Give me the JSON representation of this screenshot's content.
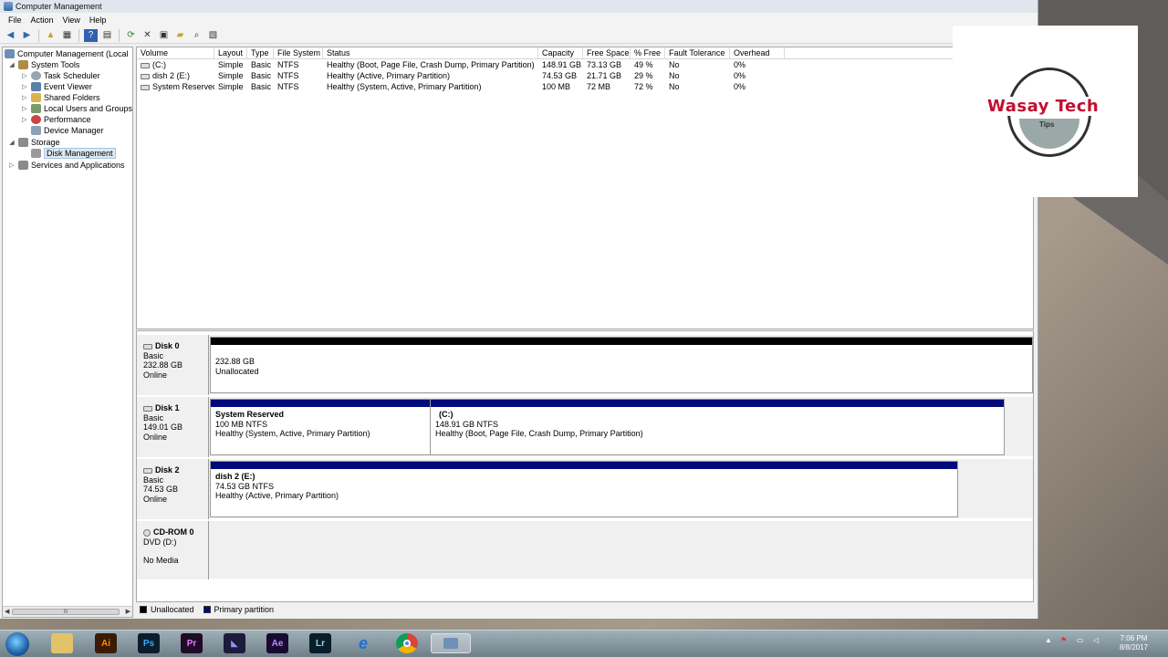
{
  "window": {
    "title": "Computer Management"
  },
  "menu": [
    "File",
    "Action",
    "View",
    "Help"
  ],
  "toolbar": {
    "icons": [
      "back-arrow-icon",
      "forward-arrow-icon",
      "up-folder-icon",
      "show-hide-tree-icon",
      "help-icon",
      "properties-icon",
      "refresh-icon",
      "delete-icon",
      "disk-properties-icon",
      "open-icon",
      "search-icon",
      "export-icon"
    ]
  },
  "tree": {
    "root": "Computer Management (Local",
    "system_tools": "System Tools",
    "task_scheduler": "Task Scheduler",
    "event_viewer": "Event Viewer",
    "shared_folders": "Shared Folders",
    "local_users": "Local Users and Groups",
    "performance": "Performance",
    "device_manager": "Device Manager",
    "storage": "Storage",
    "disk_management": "Disk Management",
    "services": "Services and Applications",
    "hscroll_thumb": "III"
  },
  "volumes": {
    "headers": [
      "Volume",
      "Layout",
      "Type",
      "File System",
      "Status",
      "Capacity",
      "Free Space",
      "% Free",
      "Fault Tolerance",
      "Overhead"
    ],
    "rows": [
      [
        "(C:)",
        "Simple",
        "Basic",
        "NTFS",
        "Healthy (Boot, Page File, Crash Dump, Primary Partition)",
        "148.91 GB",
        "73.13 GB",
        "49 %",
        "No",
        "0%"
      ],
      [
        "dish 2 (E:)",
        "Simple",
        "Basic",
        "NTFS",
        "Healthy (Active, Primary Partition)",
        "74.53 GB",
        "21.71 GB",
        "29 %",
        "No",
        "0%"
      ],
      [
        "System Reserved",
        "Simple",
        "Basic",
        "NTFS",
        "Healthy (System, Active, Primary Partition)",
        "100 MB",
        "72 MB",
        "72 %",
        "No",
        "0%"
      ]
    ]
  },
  "disks": {
    "disk0": {
      "name": "Disk 0",
      "type": "Basic",
      "size": "232.88 GB",
      "state": "Online",
      "p1": {
        "size": "232.88 GB",
        "desc": "Unallocated"
      }
    },
    "disk1": {
      "name": "Disk 1",
      "type": "Basic",
      "size": "149.01 GB",
      "state": "Online",
      "p1": {
        "name": "System Reserved",
        "size": "100 MB NTFS",
        "status": "Healthy (System, Active, Primary Partition)"
      },
      "p2": {
        "name": "(C:)",
        "size": "148.91 GB NTFS",
        "status": "Healthy (Boot, Page File, Crash Dump, Primary Partition)"
      }
    },
    "disk2": {
      "name": "Disk 2",
      "type": "Basic",
      "size": "74.53 GB",
      "state": "Online",
      "p1": {
        "name": "dish 2  (E:)",
        "size": "74.53 GB NTFS",
        "status": "Healthy (Active, Primary Partition)"
      }
    },
    "cdrom": {
      "name": "CD-ROM 0",
      "type": "DVD (D:)",
      "state": "No Media"
    }
  },
  "legend": {
    "unallocated": "Unallocated",
    "primary": "Primary partition"
  },
  "colors": {
    "unallocated": "#000000",
    "primary": "#000a7a",
    "logo_red": "#c01030"
  },
  "logo": {
    "brand": "Wasay Tech",
    "tagline": "Tips"
  },
  "taskbar": {
    "apps": [
      {
        "label": "",
        "icon": "folder-icon"
      },
      {
        "label": "Ai",
        "icon": "illustrator-icon"
      },
      {
        "label": "Ps",
        "icon": "photoshop-icon"
      },
      {
        "label": "Pr",
        "icon": "premiere-icon"
      },
      {
        "label": "",
        "icon": "media-encoder-icon"
      },
      {
        "label": "Ae",
        "icon": "after-effects-icon"
      },
      {
        "label": "Lr",
        "icon": "lightroom-icon"
      },
      {
        "label": "e",
        "icon": "internet-explorer-icon"
      },
      {
        "label": "",
        "icon": "chrome-icon"
      },
      {
        "label": "",
        "icon": "computer-management-icon"
      }
    ],
    "time": "7:06 PM",
    "date": "8/8/2017"
  }
}
